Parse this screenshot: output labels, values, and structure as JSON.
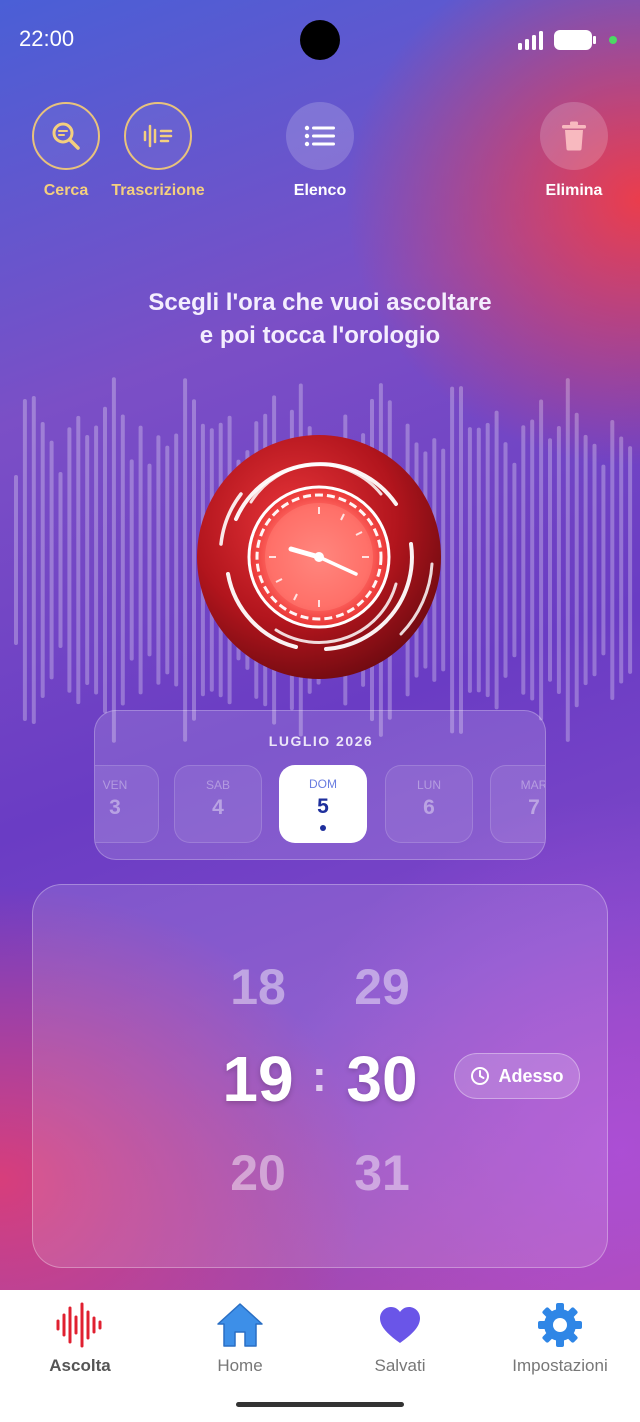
{
  "status_bar": {
    "time": "22:00"
  },
  "toolbar": {
    "search_label": "Cerca",
    "transcription_label": "Trascrizione",
    "list_label": "Elenco",
    "delete_label": "Elimina"
  },
  "instruction": {
    "line1": "Scegli l'ora che vuoi ascoltare",
    "line2": "e poi tocca l'orologio"
  },
  "date_picker": {
    "month": "LUGLIO 2026",
    "days": [
      {
        "name": "VEN",
        "num": "3"
      },
      {
        "name": "SAB",
        "num": "4"
      },
      {
        "name": "DOM",
        "num": "5",
        "selected": true
      },
      {
        "name": "LUN",
        "num": "6"
      },
      {
        "name": "MAR",
        "num": "7"
      }
    ]
  },
  "time_picker": {
    "hours": {
      "prev": "18",
      "current": "19",
      "next": "20"
    },
    "minutes": {
      "prev": "29",
      "current": "30",
      "next": "31"
    },
    "separator": ":",
    "now_label": "Adesso"
  },
  "bottom_nav": {
    "items": [
      {
        "label": "Ascolta",
        "icon": "waveform-icon",
        "active": true
      },
      {
        "label": "Home",
        "icon": "home-icon"
      },
      {
        "label": "Salvati",
        "icon": "heart-icon"
      },
      {
        "label": "Impostazioni",
        "icon": "gear-icon"
      }
    ]
  },
  "colors": {
    "accent_gold": "#f4cf7e",
    "record_red": "#e02030",
    "selected_day_text": "#1e2f9c"
  }
}
